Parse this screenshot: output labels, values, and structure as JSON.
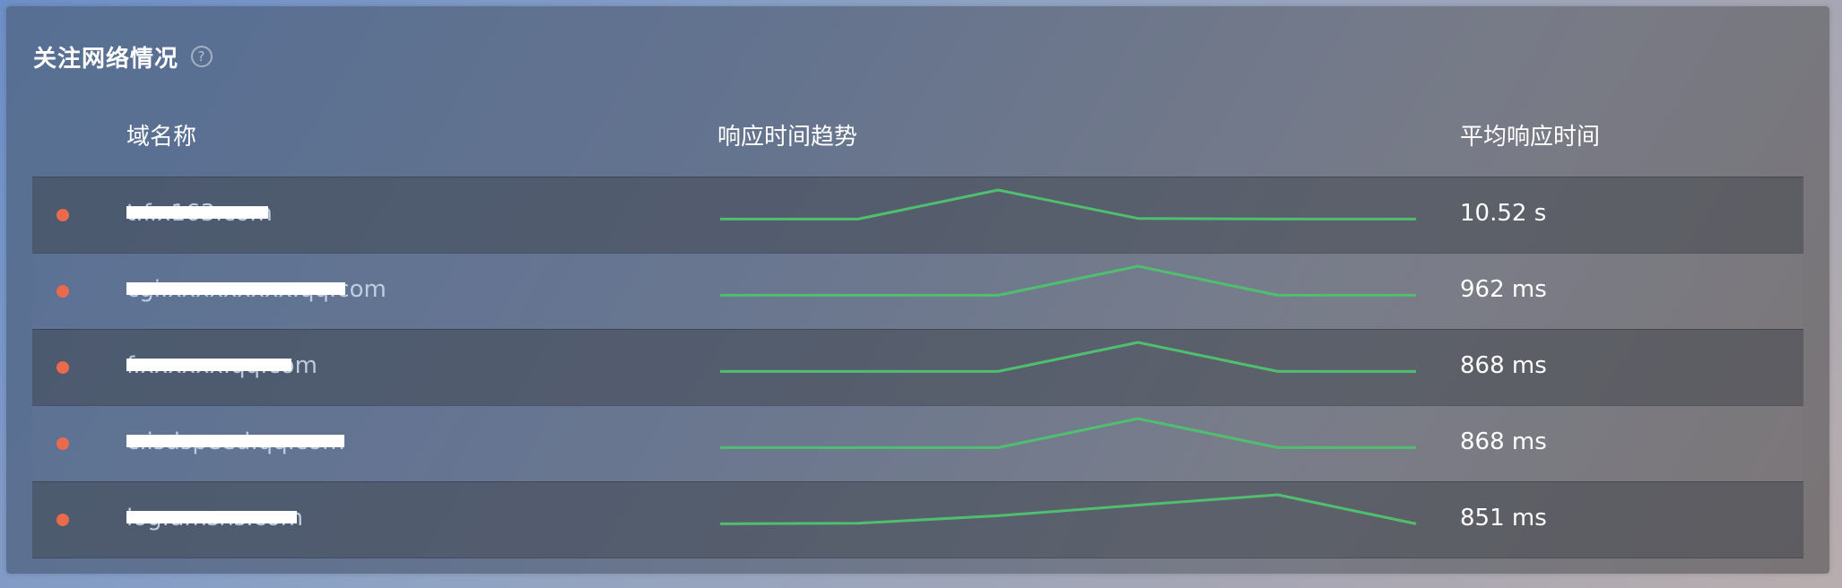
{
  "panel": {
    "title": "关注网络情况",
    "help_glyph": "?"
  },
  "table": {
    "headers": {
      "domain": "域名称",
      "trend": "响应时间趋势",
      "avg": "平均响应时间"
    },
    "rows": [
      {
        "domain": "t.f.x163.com",
        "avg": "10.52 s",
        "trend": [
          0.1,
          0.1,
          1.0,
          0.12,
          0.1,
          0.1
        ]
      },
      {
        "domain": "cgi.xxxxxxxxx.qq.com",
        "avg": "962 ms",
        "trend": [
          0.1,
          0.1,
          0.1,
          1.0,
          0.1,
          0.1
        ]
      },
      {
        "domain": "f.xxxxxx.qq.com",
        "avg": "868 ms",
        "trend": [
          0.1,
          0.1,
          0.1,
          1.0,
          0.1,
          0.1
        ]
      },
      {
        "domain": "c.isdspeed.qq.com",
        "avg": "868 ms",
        "trend": [
          0.1,
          0.1,
          0.1,
          1.0,
          0.1,
          0.1
        ]
      },
      {
        "domain": "log.umsns.com",
        "avg": "851 ms",
        "trend": [
          0.1,
          0.12,
          0.35,
          0.68,
          1.0,
          0.1
        ]
      }
    ]
  },
  "colors": {
    "status_dot": "#e96a4c",
    "spark_line": "#4fbf6f"
  }
}
